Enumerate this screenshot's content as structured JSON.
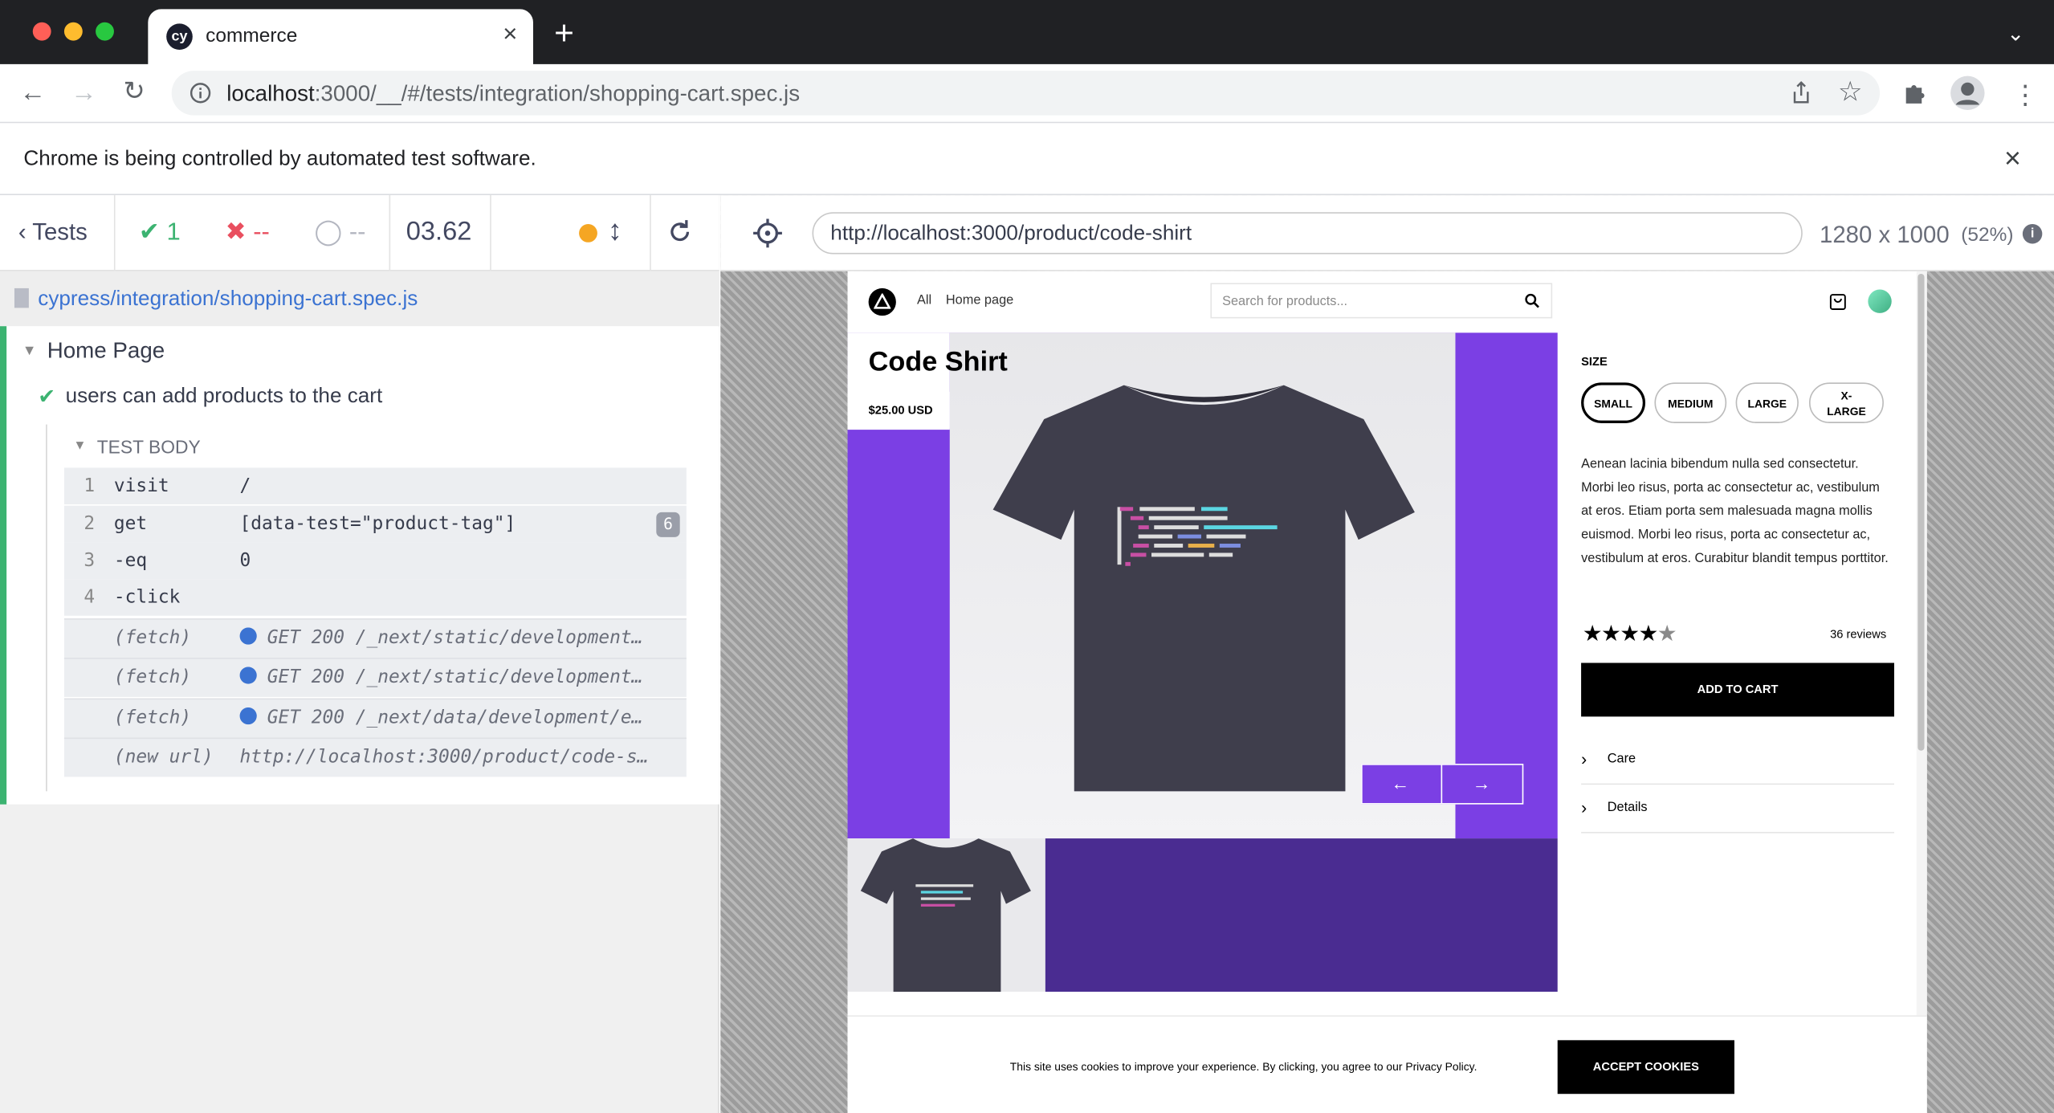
{
  "browser": {
    "tab_title": "commerce",
    "url_host": "localhost",
    "url_rest": ":3000/__/#/tests/integration/shopping-cart.spec.js",
    "infobar": "Chrome is being controlled by automated test software."
  },
  "reporter": {
    "tests_label": "Tests",
    "passed": "1",
    "failed": "--",
    "pending": "--",
    "duration": "03.62",
    "spec_path": "cypress/integration/shopping-cart.spec.js",
    "suite": "Home Page",
    "test": "users can add products to the cart",
    "section": "TEST BODY",
    "commands": [
      {
        "n": "1",
        "cmd": "visit",
        "val": "/"
      },
      {
        "n": "2",
        "cmd": "get",
        "val": "[data-test=\"product-tag\"]",
        "badge": "6"
      },
      {
        "n": "3",
        "cmd": "-eq",
        "val": "0"
      },
      {
        "n": "4",
        "cmd": "-click",
        "val": ""
      },
      {
        "n": "",
        "cmd": "(fetch)",
        "val": "GET 200 /_next/static/development…"
      },
      {
        "n": "",
        "cmd": "(fetch)",
        "val": "GET 200 /_next/static/development…"
      },
      {
        "n": "",
        "cmd": "(fetch)",
        "val": "GET 200 /_next/data/development/e…"
      },
      {
        "n": "",
        "cmd": "(new url)",
        "val": "http://localhost:3000/product/code-s…"
      }
    ]
  },
  "aut": {
    "url": "http://localhost:3000/product/code-shirt",
    "viewport": "1280 x 1000",
    "scale": "(52%)"
  },
  "store": {
    "nav_all": "All",
    "nav_home": "Home page",
    "search_placeholder": "Search for products...",
    "product_title": "Code Shirt",
    "price": "$25.00 USD",
    "size_label": "SIZE",
    "sizes": [
      "SMALL",
      "MEDIUM",
      "LARGE",
      "X-LARGE"
    ],
    "description": "Aenean lacinia bibendum nulla sed consectetur. Morbi leo risus, porta ac consectetur ac, vestibulum at eros. Etiam porta sem malesuada magna mollis euismod. Morbi leo risus, porta ac consectetur ac, vestibulum at eros. Curabitur blandit tempus porttitor.",
    "rating": 4,
    "reviews": "36 reviews",
    "add_to_cart": "ADD TO CART",
    "care": "Care",
    "details": "Details",
    "cookie_text": "This site uses cookies to improve your experience. By clicking, you agree to our Privacy Policy.",
    "accept_cookies": "ACCEPT COOKIES",
    "accent": "#7b3fe4"
  }
}
